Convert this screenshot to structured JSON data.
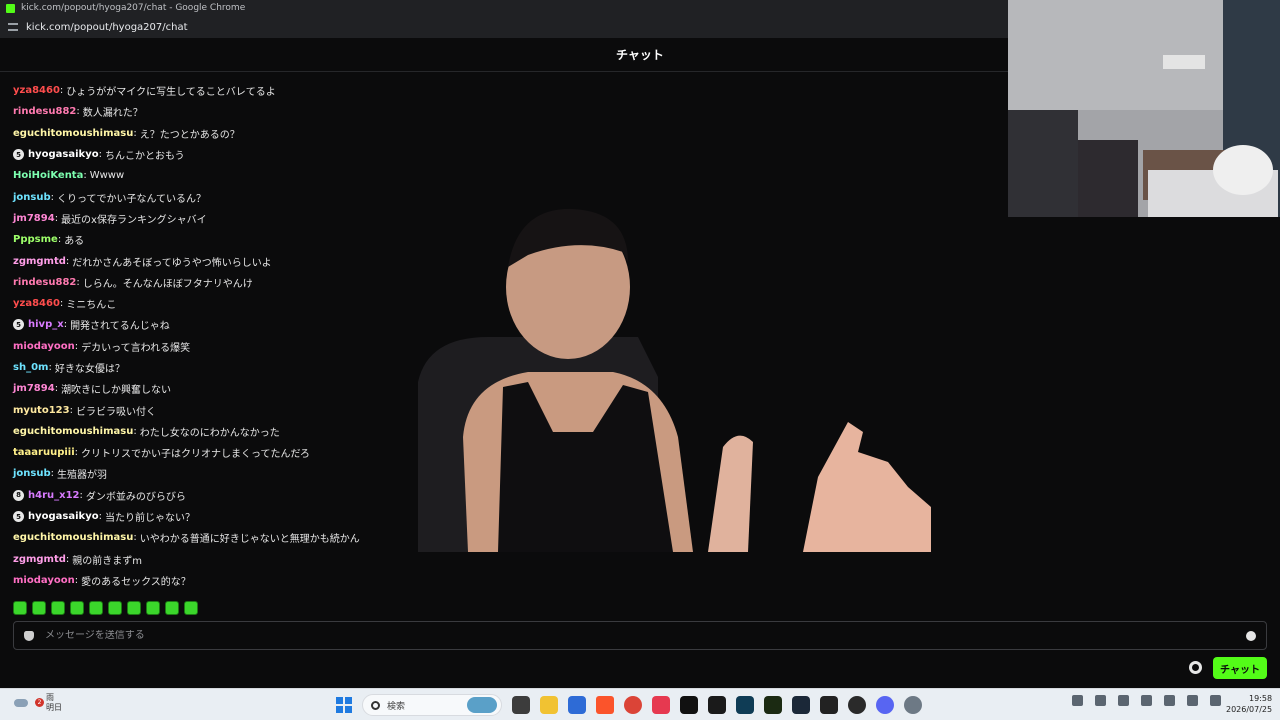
{
  "browser": {
    "window_title": "kick.com/popout/hyoga207/chat - Google Chrome",
    "url": "kick.com/popout/hyoga207/chat"
  },
  "chat": {
    "title": "チャット",
    "messages": [
      {
        "user": "yza8460",
        "color": "#ff4d4d",
        "badge": "",
        "text": "ひょうががマイクに写生してることバレてるよ"
      },
      {
        "user": "rindesu882",
        "color": "#ff7ab0",
        "badge": "",
        "text": "数人漏れた？"
      },
      {
        "user": "eguchitomoushimasu",
        "color": "#fff6a8",
        "badge": "",
        "text": "え？たつとかあるの？"
      },
      {
        "user": "hyogasaikyo",
        "color": "#ffffff",
        "badge": "5",
        "text": "ちんこかとおもう"
      },
      {
        "user": "HoiHoiKenta",
        "color": "#7dffb0",
        "badge": "",
        "text": "Wwww"
      },
      {
        "user": "jonsub",
        "color": "#6ee3ff",
        "badge": "",
        "text": "くりってでかい子なんているん？"
      },
      {
        "user": "jm7894",
        "color": "#ff86d4",
        "badge": "",
        "text": "最近のx保存ランキングシャバイ"
      },
      {
        "user": "Pppsme",
        "color": "#9dff6a",
        "badge": "",
        "text": "ある"
      },
      {
        "user": "zgmgmtd",
        "color": "#ff9ee8",
        "badge": "",
        "text": "だれかさんあそぼってゆうやつ怖いらしいよ"
      },
      {
        "user": "rindesu882",
        "color": "#ff7ab0",
        "badge": "",
        "text": "しらん。そんなんほぼフタナリやんけ"
      },
      {
        "user": "yza8460",
        "color": "#ff4d4d",
        "badge": "",
        "text": "ミニちんこ"
      },
      {
        "user": "hivp_x",
        "color": "#d87bff",
        "badge": "5",
        "text": "開発されてるんじゃね"
      },
      {
        "user": "miodayoon",
        "color": "#ff6fc4",
        "badge": "",
        "text": "デカいって言われる爆笑"
      },
      {
        "user": "sh_0m",
        "color": "#6ee3ff",
        "badge": "",
        "text": "好きな女優は？"
      },
      {
        "user": "jm7894",
        "color": "#ff86d4",
        "badge": "",
        "text": "潮吹きにしか興奮しない"
      },
      {
        "user": "myuto123",
        "color": "#ffe9a0",
        "badge": "",
        "text": "ビラビラ吸い付く"
      },
      {
        "user": "eguchitomoushimasu",
        "color": "#fff6a8",
        "badge": "",
        "text": "わたし女なのにわかんなかった"
      },
      {
        "user": "taaaruupiii",
        "color": "#fff08a",
        "badge": "",
        "text": "クリトリスでかい子はクリオナしまくってたんだろ"
      },
      {
        "user": "jonsub",
        "color": "#6ee3ff",
        "badge": "",
        "text": "生殖器が羽"
      },
      {
        "user": "h4ru_x12",
        "color": "#d87bff",
        "badge": "8",
        "text": "ダンボ並みのびらびら"
      },
      {
        "user": "hyogasaikyo",
        "color": "#ffffff",
        "badge": "5",
        "text": "当たり前じゃない？"
      },
      {
        "user": "eguchitomoushimasu",
        "color": "#fff6a8",
        "badge": "",
        "text": "いやわかる普通に好きじゃないと無理かも続かん"
      },
      {
        "user": "zgmgmtd",
        "color": "#ff9ee8",
        "badge": "",
        "text": "親の前きまずm"
      },
      {
        "user": "miodayoon",
        "color": "#ff6fc4",
        "badge": "",
        "text": "愛のあるセックス的な？"
      }
    ],
    "input_placeholder": "メッセージを送信する",
    "send_label": "チャット",
    "accent_color": "#53fc18"
  },
  "taskbar": {
    "weather_badge": "2",
    "weather_line1": "雨",
    "weather_line2": "明日",
    "search_placeholder": "検索",
    "time": "19:58",
    "date": "2026/07/25"
  }
}
